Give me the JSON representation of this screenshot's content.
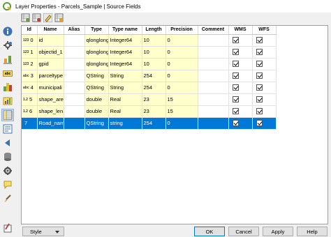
{
  "window": {
    "title": "Layer Properties - Parcels_Sample | Source Fields"
  },
  "sidebar": {
    "items": [
      {
        "icon": "info-icon"
      },
      {
        "icon": "source-icon"
      },
      {
        "icon": "symbology-icon"
      },
      {
        "icon": "labels-icon",
        "text": "abc"
      },
      {
        "icon": "masks-icon"
      },
      {
        "icon": "diagrams-icon"
      },
      {
        "icon": "source-fields-icon"
      },
      {
        "icon": "attributes-form-icon"
      },
      {
        "icon": "joins-icon"
      },
      {
        "icon": "auxiliary-storage-icon"
      },
      {
        "icon": "actions-icon"
      },
      {
        "icon": "display-icon"
      },
      {
        "icon": "rendering-icon"
      },
      {
        "icon": "variables-icon"
      }
    ]
  },
  "toolbar": {
    "buttons": [
      "new-field-icon",
      "delete-field-icon",
      "toggle-editing-icon",
      "field-calculator-icon"
    ]
  },
  "table": {
    "headers": [
      "Id",
      "Name",
      "Alias",
      "Type",
      "Type name",
      "Length",
      "Precision",
      "Comment",
      "WMS",
      "WFS"
    ],
    "rows": [
      {
        "icon": "123",
        "id": "0",
        "name": "id",
        "alias": "",
        "type": "qlonglong",
        "typename": "Integer64",
        "length": "10",
        "precision": "0",
        "comment": "",
        "selected": false
      },
      {
        "icon": "123",
        "id": "1",
        "name": "objectid_1",
        "alias": "",
        "type": "qlonglong",
        "typename": "Integer64",
        "length": "10",
        "precision": "0",
        "comment": "",
        "selected": false
      },
      {
        "icon": "123",
        "id": "2",
        "name": "gpid",
        "alias": "",
        "type": "qlonglong",
        "typename": "Integer64",
        "length": "10",
        "precision": "0",
        "comment": "",
        "selected": false
      },
      {
        "icon": "abc",
        "id": "3",
        "name": "parceltype",
        "alias": "",
        "type": "QString",
        "typename": "String",
        "length": "254",
        "precision": "0",
        "comment": "",
        "selected": false
      },
      {
        "icon": "abc",
        "id": "4",
        "name": "municipali",
        "alias": "",
        "type": "QString",
        "typename": "String",
        "length": "254",
        "precision": "0",
        "comment": "",
        "selected": false
      },
      {
        "icon": "1.2",
        "id": "5",
        "name": "shape_area",
        "alias": "",
        "type": "double",
        "typename": "Real",
        "length": "23",
        "precision": "15",
        "comment": "",
        "selected": false
      },
      {
        "icon": "1.2",
        "id": "6",
        "name": "shape_len",
        "alias": "",
        "type": "double",
        "typename": "Real",
        "length": "23",
        "precision": "15",
        "comment": "",
        "selected": false
      },
      {
        "icon": "",
        "id": "7",
        "name": "Road_name",
        "alias": "",
        "type": "QString",
        "typename": "string",
        "length": "254",
        "precision": "0",
        "comment": "",
        "selected": true
      }
    ]
  },
  "buttons": {
    "style": "Style",
    "ok": "OK",
    "cancel": "Cancel",
    "apply": "Apply",
    "help": "Help"
  },
  "colors": {
    "row_bg": "#ffffcc",
    "selection": "#0078d7",
    "qgis_green": "#6ea040"
  }
}
